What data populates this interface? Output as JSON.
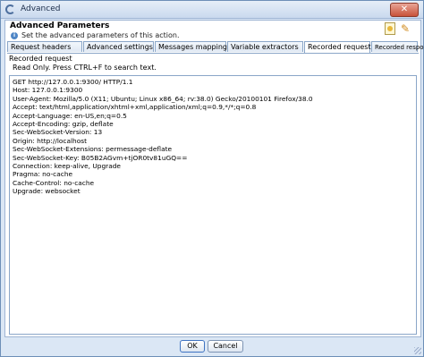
{
  "window": {
    "title": "Advanced",
    "close_symbol": "✕"
  },
  "header": {
    "title": "Advanced Parameters",
    "subtitle": "Set the advanced parameters of this action."
  },
  "tabs": [
    {
      "label": "Request headers"
    },
    {
      "label": "Advanced settings"
    },
    {
      "label": "Messages mapping"
    },
    {
      "label": "Variable extractors"
    },
    {
      "label": "Recorded request",
      "active": true
    },
    {
      "label": "Recorded response"
    }
  ],
  "panel": {
    "title": "Recorded request",
    "note": "Read Only. Press CTRL+F to search text.",
    "lines": [
      "GET http://127.0.0.1:9300/ HTTP/1.1",
      "Host: 127.0.0.1:9300",
      "User-Agent: Mozilla/5.0 (X11; Ubuntu; Linux x86_64; rv:38.0) Gecko/20100101 Firefox/38.0",
      "Accept: text/html,application/xhtml+xml,application/xml;q=0.9,*/*;q=0.8",
      "Accept-Language: en-US,en;q=0.5",
      "Accept-Encoding: gzip, deflate",
      "Sec-WebSocket-Version: 13",
      "Origin: http://localhost",
      "Sec-WebSocket-Extensions: permessage-deflate",
      "Sec-WebSocket-Key: B05B2AGvm+tjOR0tv81uGQ==",
      "Connection: keep-alive, Upgrade",
      "Pragma: no-cache",
      "Cache-Control: no-cache",
      "Upgrade: websocket"
    ]
  },
  "footer": {
    "ok_label": "OK",
    "cancel_label": "Cancel"
  },
  "icons": {
    "app": "app-icon",
    "info": "info-icon",
    "help": "help-icon",
    "tool": "tool-icon"
  },
  "colors": {
    "accent": "#3f74c2",
    "title_bar": "#c9d9ee",
    "close": "#c8523a"
  }
}
